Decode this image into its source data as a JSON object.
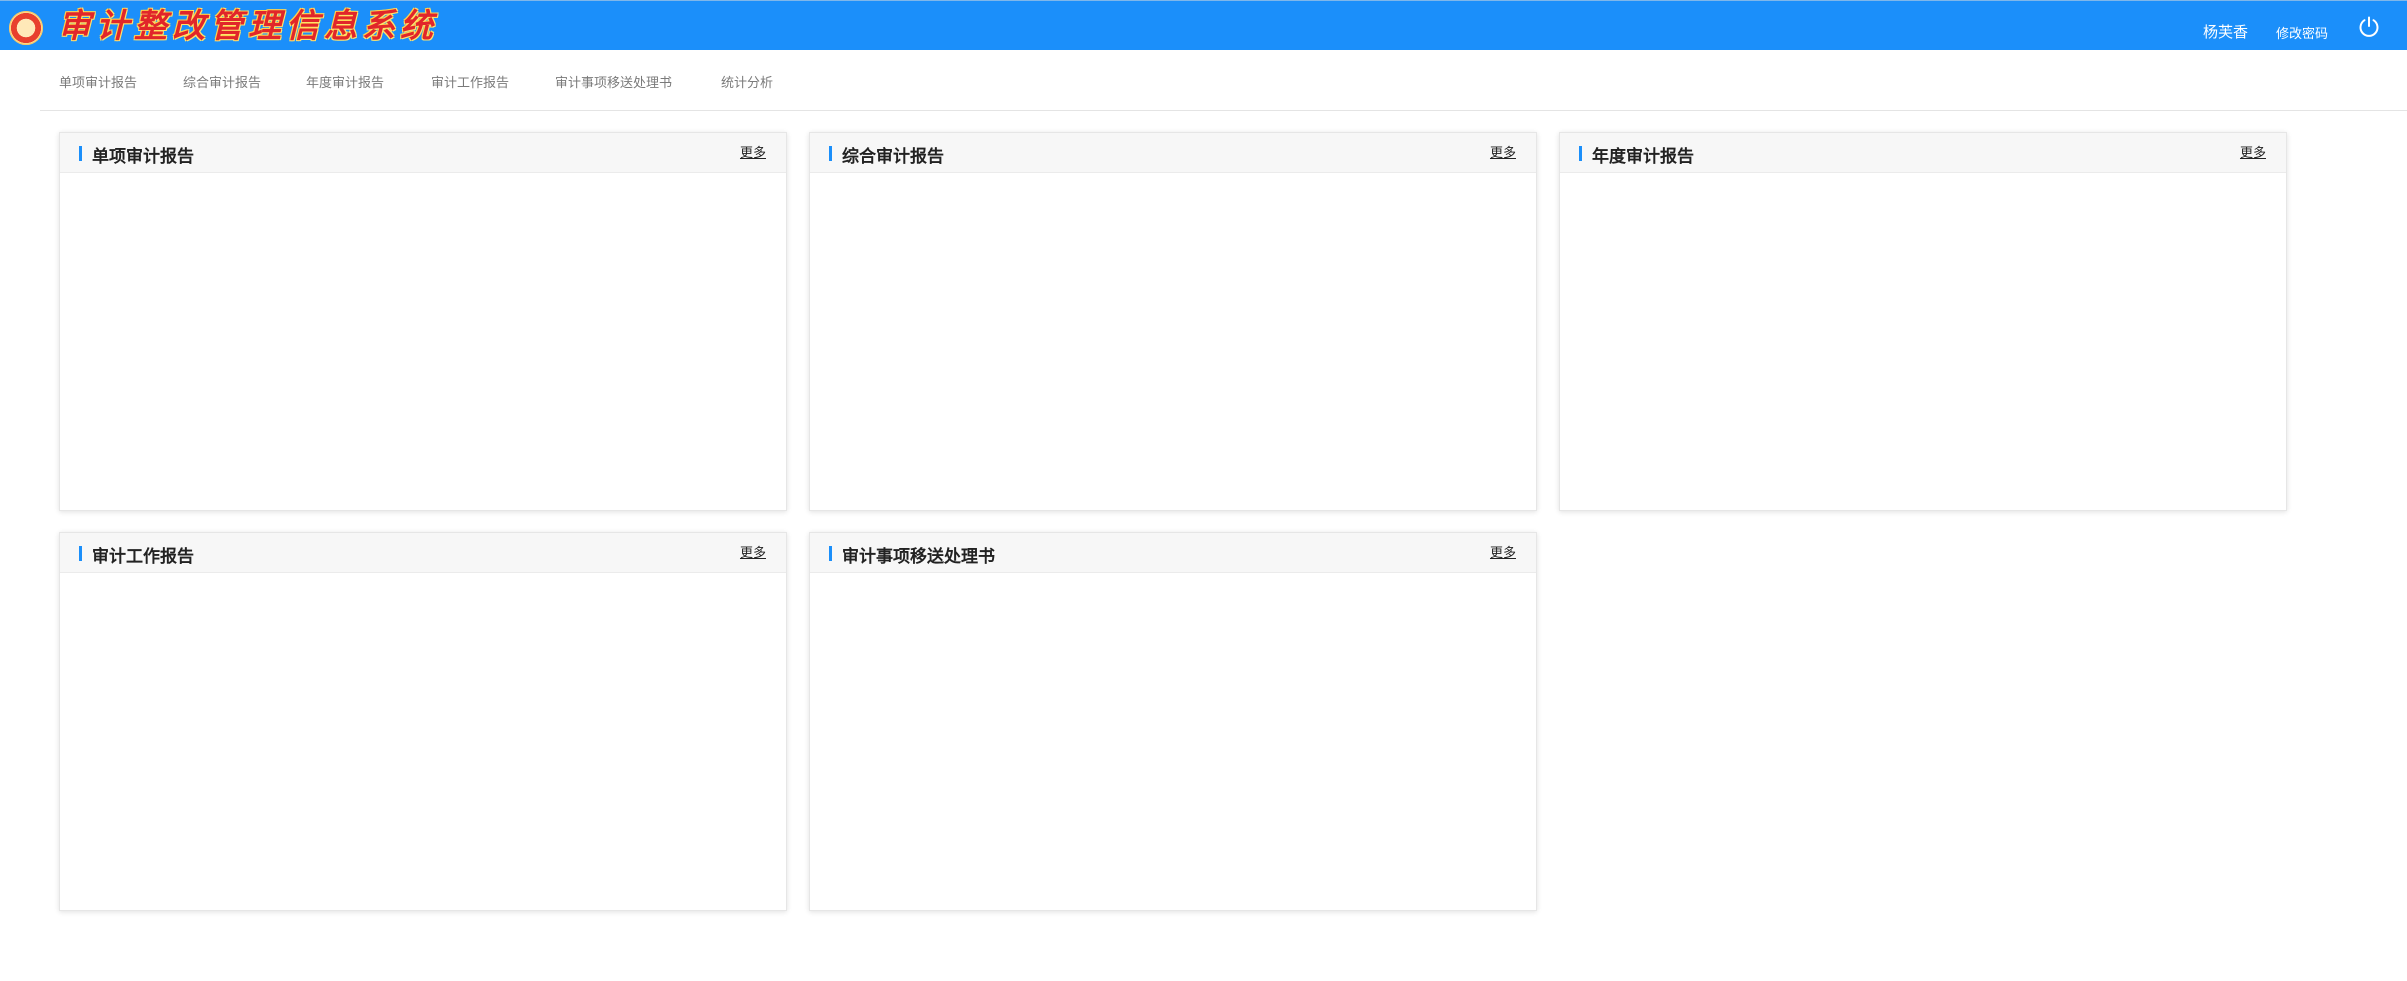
{
  "header": {
    "system_title": "审计整改管理信息系统",
    "user_name": "杨芙香",
    "change_password": "修改密码",
    "logo_icon": "emblem-icon",
    "power_icon": "power-icon"
  },
  "nav": {
    "items": [
      {
        "label": "单项审计报告"
      },
      {
        "label": "综合审计报告"
      },
      {
        "label": "年度审计报告"
      },
      {
        "label": "审计工作报告"
      },
      {
        "label": "审计事项移送处理书"
      },
      {
        "label": "统计分析"
      }
    ]
  },
  "panels": [
    {
      "title": "单项审计报告",
      "more": "更多"
    },
    {
      "title": "综合审计报告",
      "more": "更多"
    },
    {
      "title": "年度审计报告",
      "more": "更多"
    },
    {
      "title": "审计工作报告",
      "more": "更多"
    },
    {
      "title": "审计事项移送处理书",
      "more": "更多"
    }
  ],
  "colors": {
    "header_bg": "#1b8ffa",
    "accent": "#1b8ffa",
    "title_red": "#e1262a"
  }
}
